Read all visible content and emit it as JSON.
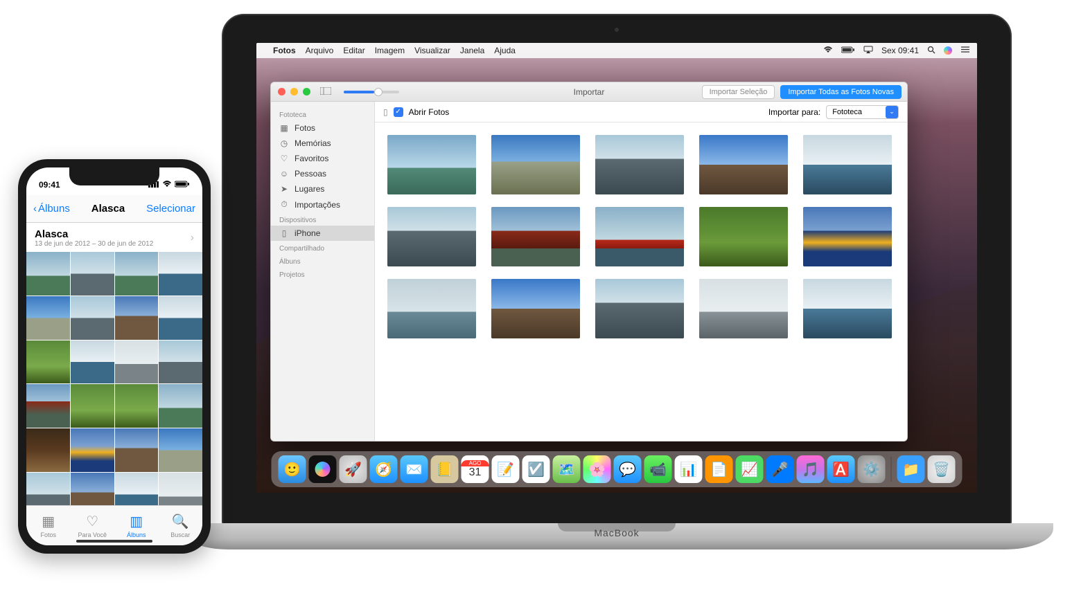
{
  "mac": {
    "label": "MacBook",
    "menubar": {
      "app": "Fotos",
      "items": [
        "Arquivo",
        "Editar",
        "Imagem",
        "Visualizar",
        "Janela",
        "Ajuda"
      ],
      "clock": "Sex 09:41"
    },
    "window": {
      "title": "Importar",
      "btn_import_selection": "Importar Seleção",
      "btn_import_all": "Importar Todas as Fotos Novas",
      "sidebar": {
        "section_library": "Fototeca",
        "library_items": [
          "Fotos",
          "Memórias",
          "Favoritos",
          "Pessoas",
          "Lugares",
          "Importações"
        ],
        "section_devices": "Dispositivos",
        "device_items": [
          "iPhone"
        ],
        "section_shared": "Compartilhado",
        "section_albums": "Álbuns",
        "section_projects": "Projetos"
      },
      "toolbar": {
        "open_photos": "Abrir Fotos",
        "import_to_label": "Importar para:",
        "import_to_value": "Fototeca"
      }
    },
    "dock": {
      "items": [
        "finder",
        "siri",
        "launchpad",
        "safari",
        "mail",
        "contacts",
        "calendar",
        "notes",
        "reminders",
        "maps",
        "photos",
        "messages",
        "facetime",
        "stocks",
        "pages",
        "keynote",
        "numbers",
        "itunes",
        "appstore",
        "settings"
      ],
      "calendar_month": "AGO",
      "calendar_day": "31",
      "right_items": [
        "downloads",
        "trash"
      ]
    }
  },
  "iphone": {
    "status_time": "09:41",
    "nav_back": "Álbuns",
    "nav_title": "Alasca",
    "nav_action": "Selecionar",
    "album_title": "Alasca",
    "album_subtitle": "13 de jun de 2012 – 30 de jun de 2012",
    "tabs": {
      "photos": "Fotos",
      "for_you": "Para Você",
      "albums": "Álbuns",
      "search": "Buscar"
    }
  }
}
